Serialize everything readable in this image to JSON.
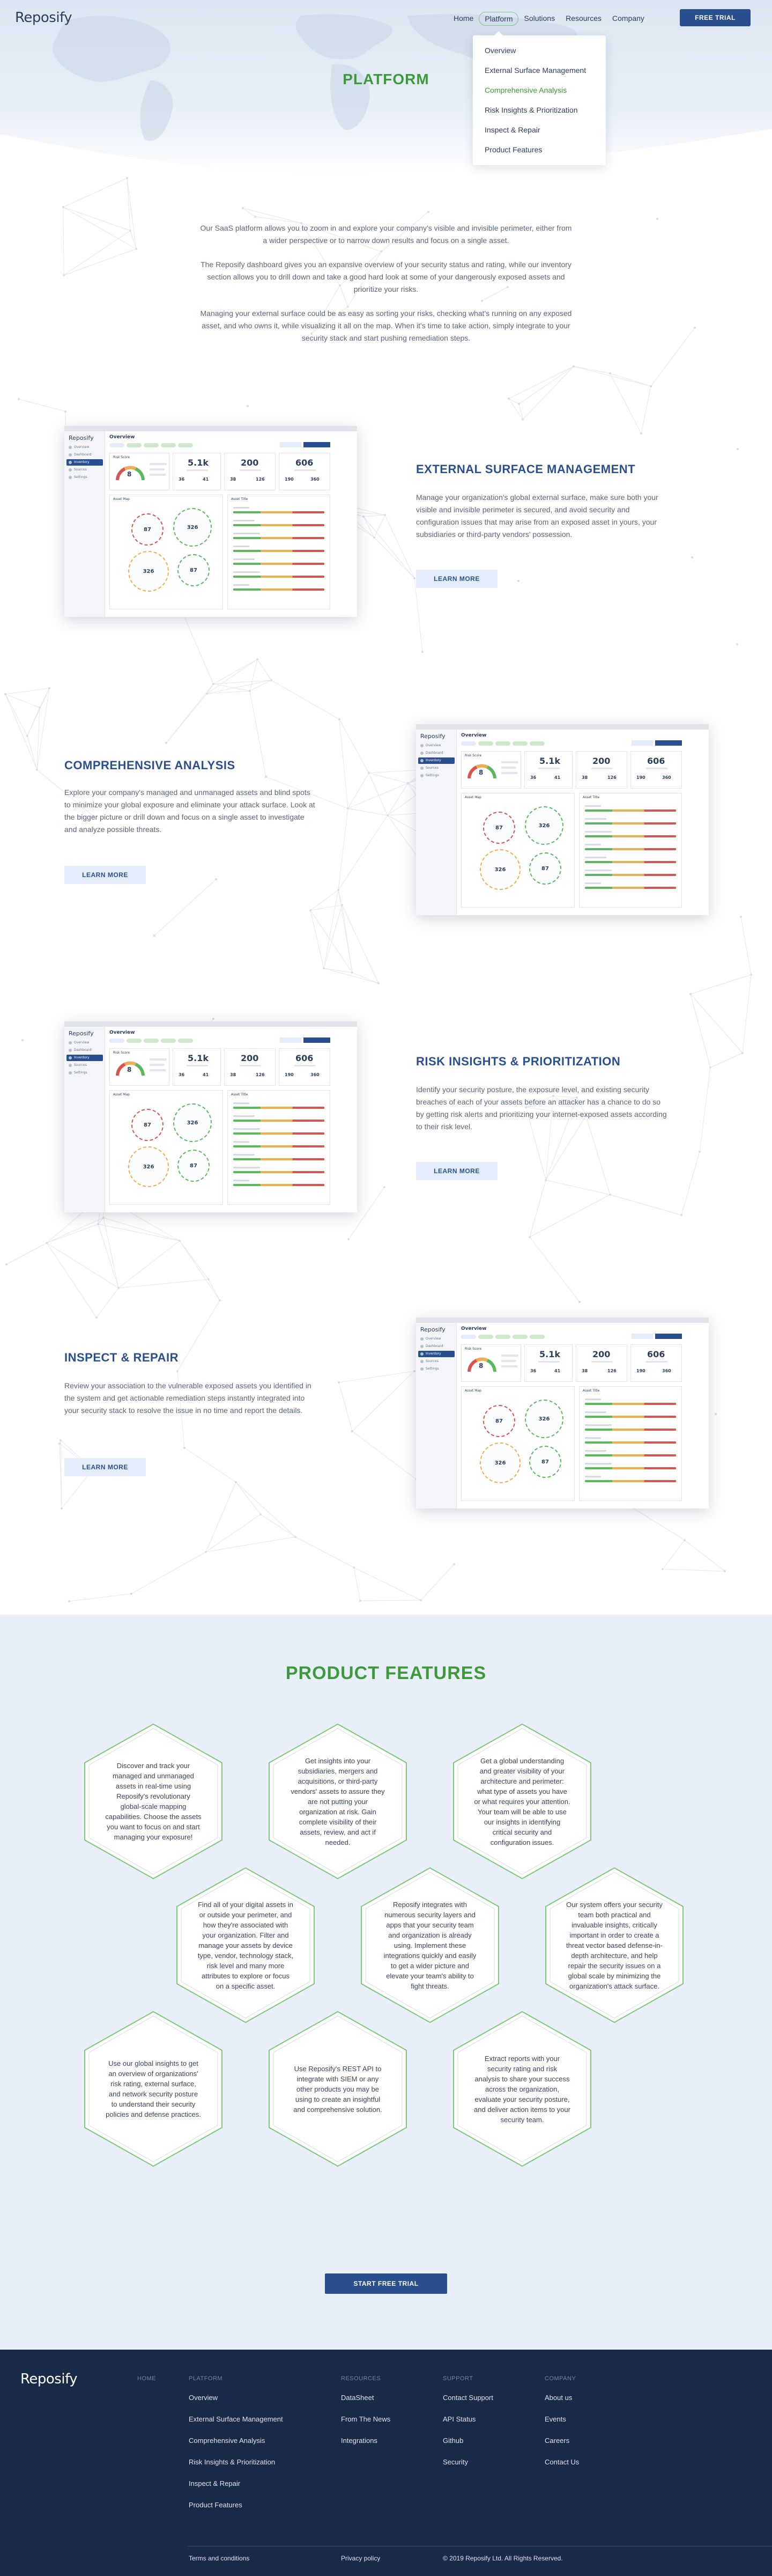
{
  "header": {
    "logo": "Reposify",
    "nav": [
      {
        "label": "Home"
      },
      {
        "label": "Platform"
      },
      {
        "label": "Solutions"
      },
      {
        "label": "Resources"
      },
      {
        "label": "Company"
      }
    ],
    "cta_label": "FREE TRIAL"
  },
  "platform_menu": {
    "items": [
      {
        "label": "Overview"
      },
      {
        "label": "External Surface Management"
      },
      {
        "label": "Comprehensive Analysis"
      },
      {
        "label": "Risk Insights & Prioritization"
      },
      {
        "label": "Inspect & Repair"
      },
      {
        "label": "Product Features"
      }
    ],
    "active_index": 2
  },
  "hero": {
    "title": "PLATFORM"
  },
  "intro": {
    "paragraphs": [
      "Our SaaS platform allows you to zoom in and explore your company's visible and invisible perimeter, either from a wider perspective or to narrow down results and focus on a single asset.",
      "The Reposify dashboard gives you an expansive overview of your security status and rating, while our inventory section allows you to drill down and take a good hard look at some of your dangerously exposed assets and prioritize your risks.",
      "Managing your external surface could be as easy as sorting your risks, checking what's running on any exposed asset, and who owns it, while visualizing it all on the map. When it's time to take action, simply integrate to your security stack and start pushing remediation steps."
    ]
  },
  "features": [
    {
      "title": "EXTERNAL SURFACE MANAGEMENT",
      "text": "Manage your organization's global external surface, make sure both your visible and invisible perimeter is secured, and avoid security and configuration issues that may arise from an exposed asset in yours, your subsidiaries or third-party vendors' possession.",
      "button": "LEARN MORE"
    },
    {
      "title": "COMPREHENSIVE ANALYSIS",
      "text": "Explore your company's managed and unmanaged assets and blind spots to minimize your global exposure and eliminate your attack surface. Look at the bigger picture or drill down and focus on a single asset to investigate and analyze possible threats.",
      "button": "LEARN MORE"
    },
    {
      "title": "RISK INSIGHTS & PRIORITIZATION",
      "text": "Identify your security posture, the exposure level, and existing security breaches of each of your assets before an attacker has a chance to do so by getting risk alerts and prioritizing your internet-exposed assets according to their risk level.",
      "button": "LEARN MORE"
    },
    {
      "title": "INSPECT & REPAIR",
      "text": "Review your association to the vulnerable exposed assets you identified in the system and get actionable remediation steps instantly integrated into your security stack to resolve the issue in no time and report the details.",
      "button": "LEARN MORE"
    }
  ],
  "dashboard_mock": {
    "logo": "Reposify",
    "title": "Overview",
    "nav": [
      "Overview",
      "Dashboard",
      "Inventory",
      "Sources",
      "Settings"
    ],
    "selected_nav": 2,
    "risk_label": "Risk Score",
    "risk_score": "8",
    "stat1": "5.1k",
    "stat2": "200",
    "stat3": "606",
    "mini_stats": [
      "36",
      "41",
      "38",
      "126",
      "190",
      "360"
    ],
    "asset_map_label": "Asset Map",
    "asset_title_label": "Asset Title",
    "bubbles": [
      "87",
      "326",
      "326",
      "87"
    ]
  },
  "product_features": {
    "title": "PRODUCT FEATURES",
    "items": [
      "Discover and track your managed and unmanaged assets in real-time using Reposify's revolutionary global-scale mapping capabilities. Choose the assets you want to focus on and start managing your exposure!",
      "Get insights into your subsidiaries, mergers and acquisitions, or third-party vendors' assets to assure they are not putting your organization at risk. Gain complete visibility of their assets, review, and act if needed.",
      "Get a global understanding and greater visibility of your architecture and perimeter: what type of assets you have or what requires your attention. Your team will be able to use our insights in identifying critical security and configuration issues.",
      "Find all of your digital assets in or outside your perimeter, and how they're associated with your organization. Filter and manage your assets by device type, vendor, technology stack, risk level and many more attributes to explore or focus on a specific asset.",
      "Reposify integrates with numerous security layers and apps that your security team and organization is already using. Implement these integrations quickly and easily to get a wider picture and elevate your team's ability to fight threats.",
      "Our system offers your security team both practical and invaluable insights, critically important in order to create a threat vector based defense-in-depth architecture, and help repair the security issues on a global scale by minimizing the organization's attack surface.",
      "Use our global insights to get an overview of organizations' risk rating, external surface, and network security posture to understand their security policies and defense practices.",
      "Use Reposify's REST API to integrate with SIEM or any other products you may be using to create an insightful and comprehensive solution.",
      "Extract reports with your security rating and risk analysis to share your success across the organization, evaluate your security posture, and deliver action items to your security team."
    ],
    "cta": "START FREE TRIAL"
  },
  "footer": {
    "logo": "Reposify",
    "home_label": "HOME",
    "platform": {
      "heading": "PLATFORM",
      "links": [
        "Overview",
        "External Surface Management",
        "Comprehensive Analysis",
        "Risk Insights & Prioritization",
        "Inspect & Repair",
        "Product Features"
      ]
    },
    "resources": {
      "heading": "RESOURCES",
      "links": [
        "DataSheet",
        "From The News",
        "Integrations"
      ]
    },
    "support": {
      "heading": "SUPPORT",
      "links": [
        "Contact Support",
        "API Status",
        "Github",
        "Security"
      ]
    },
    "company": {
      "heading": "COMPANY",
      "links": [
        "About us",
        "Events",
        "Careers",
        "Contact Us"
      ]
    },
    "bottom": {
      "terms": "Terms and conditions",
      "privacy": "Privacy policy",
      "copyright": "© 2019 Reposify Ltd. All Rights Reserved."
    }
  },
  "colors": {
    "brand_navy": "#2a4f8e",
    "brand_green": "#3d9a3a",
    "footer_bg": "#192a48",
    "features_bg": "#e8eff8"
  }
}
